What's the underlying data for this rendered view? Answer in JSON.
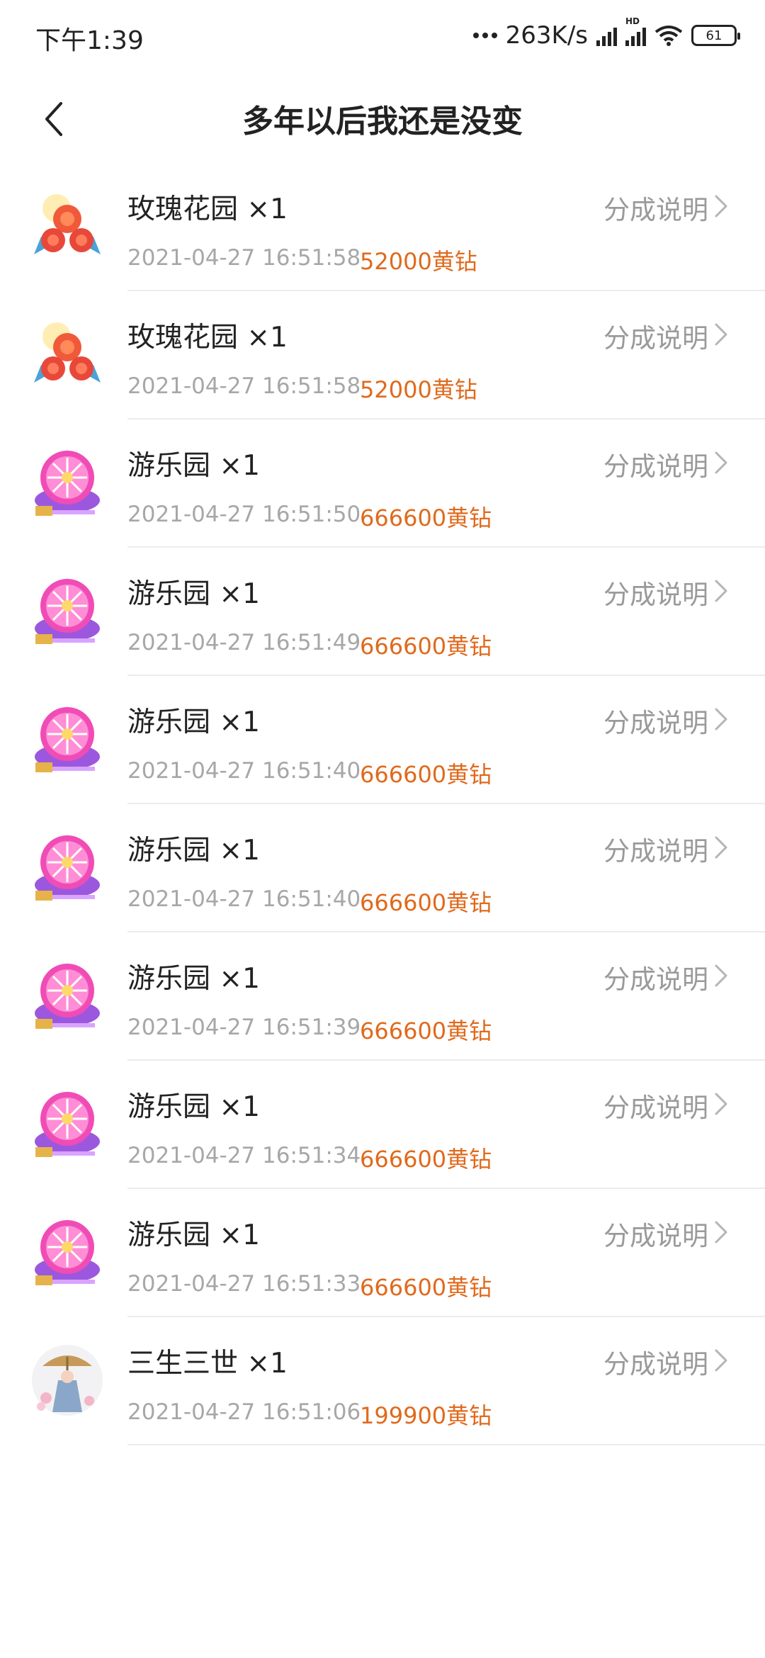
{
  "status": {
    "time": "下午1:39",
    "net_speed": "263K/s",
    "hd_label": "HD",
    "battery": "61"
  },
  "header": {
    "title": "多年以后我还是没变"
  },
  "gifts": [
    {
      "name": "玫瑰花园 ×1",
      "link": "分成说明",
      "time": "2021-04-27 16:51:58",
      "price": "52000黄钻",
      "icon": "rose-garden-icon"
    },
    {
      "name": "玫瑰花园 ×1",
      "link": "分成说明",
      "time": "2021-04-27 16:51:58",
      "price": "52000黄钻",
      "icon": "rose-garden-icon"
    },
    {
      "name": "游乐园 ×1",
      "link": "分成说明",
      "time": "2021-04-27 16:51:50",
      "price": "666600黄钻",
      "icon": "amusement-park-icon"
    },
    {
      "name": "游乐园 ×1",
      "link": "分成说明",
      "time": "2021-04-27 16:51:49",
      "price": "666600黄钻",
      "icon": "amusement-park-icon"
    },
    {
      "name": "游乐园 ×1",
      "link": "分成说明",
      "time": "2021-04-27 16:51:40",
      "price": "666600黄钻",
      "icon": "amusement-park-icon"
    },
    {
      "name": "游乐园 ×1",
      "link": "分成说明",
      "time": "2021-04-27 16:51:40",
      "price": "666600黄钻",
      "icon": "amusement-park-icon"
    },
    {
      "name": "游乐园 ×1",
      "link": "分成说明",
      "time": "2021-04-27 16:51:39",
      "price": "666600黄钻",
      "icon": "amusement-park-icon"
    },
    {
      "name": "游乐园 ×1",
      "link": "分成说明",
      "time": "2021-04-27 16:51:34",
      "price": "666600黄钻",
      "icon": "amusement-park-icon"
    },
    {
      "name": "游乐园 ×1",
      "link": "分成说明",
      "time": "2021-04-27 16:51:33",
      "price": "666600黄钻",
      "icon": "amusement-park-icon"
    },
    {
      "name": "三生三世 ×1",
      "link": "分成说明",
      "time": "2021-04-27 16:51:06",
      "price": "199900黄钻",
      "icon": "three-lives-icon"
    }
  ],
  "colors": {
    "price": "#e06a1c",
    "muted": "#9a9a9a"
  }
}
